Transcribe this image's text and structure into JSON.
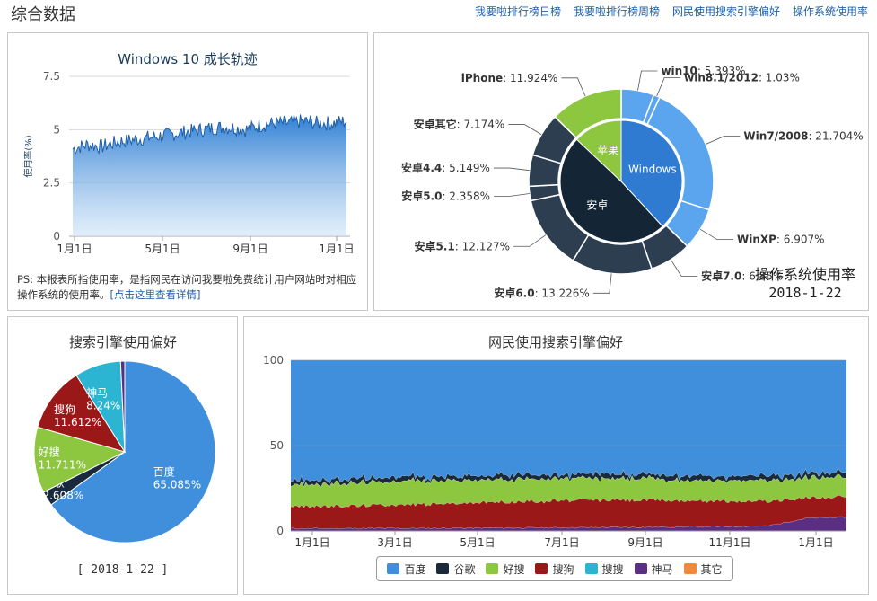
{
  "header": {
    "title": "综合数据",
    "links": [
      "我要啦排行榜日榜",
      "我要啦排行榜周榜",
      "网民使用搜索引擎偏好",
      "操作系统使用率"
    ]
  },
  "colors": {
    "baidu": "#3f8fdc",
    "google": "#1a2a3c",
    "haosou": "#8dc63f",
    "sogou": "#9b1818",
    "shenma": "#2bb5d3",
    "other": "#f08a3a",
    "shenma_dark": "#5a2e83",
    "win_inner": "#2e7bd1",
    "win_outer": "#5aa5ee",
    "android_inner": "#142536",
    "android_outer": "#2c3e50",
    "apple": "#8dc63f"
  },
  "panel1": {
    "ps_text": "PS: 本报表所指使用率，是指网民在访问我要啦免费统计用户网站时对相应操作系统的使用率。",
    "ps_link": "[点击这里查看详情]"
  },
  "panel2": {
    "stamp_title": "操作系统使用率",
    "stamp_date": "2018-1-22"
  },
  "panel3": {
    "date": "[ 2018-1-22 ]"
  },
  "chart_data": [
    {
      "type": "area",
      "title": "Windows 10 成长轨迹",
      "ylabel": "使用率(%)",
      "ylim": [
        0,
        7.5
      ],
      "yticks": [
        0,
        2.5,
        5,
        7.5
      ],
      "xticks": [
        "1月1日",
        "5月1日",
        "9月1日",
        "1月1日"
      ],
      "x_range": [
        "2017-01-01",
        "2018-01-22"
      ],
      "series": [
        {
          "values": [
            4.1,
            4.3,
            4.2,
            4.4,
            4.5,
            4.6,
            4.7,
            4.8,
            4.9,
            5.0,
            5.1,
            5.1,
            5.0,
            5.2,
            5.3,
            5.3,
            5.4,
            5.3,
            5.3,
            5.4
          ]
        }
      ]
    },
    {
      "type": "pie",
      "inner": [
        {
          "label": "Windows",
          "value": 35.1
        },
        {
          "label": "安卓",
          "value": 45.0
        },
        {
          "label": "苹果",
          "value": 11.924
        }
      ],
      "outer": [
        {
          "label": "win10",
          "value": 5.393
        },
        {
          "label": "win8.1/2012",
          "value": 1.03
        },
        {
          "label": "Win7/2008",
          "value": 21.704
        },
        {
          "label": "WinXP",
          "value": 6.907
        },
        {
          "label": "安卓7.0",
          "value": 6.85
        },
        {
          "label": "安卓6.0",
          "value": 13.226
        },
        {
          "label": "安卓5.1",
          "value": 12.127
        },
        {
          "label": "安卓5.0",
          "value": 2.358
        },
        {
          "label": "安卓4.4",
          "value": 5.149
        },
        {
          "label": "安卓其它",
          "value": 7.174
        },
        {
          "label": "iPhone",
          "value": 11.924
        }
      ],
      "labels": [
        {
          "text": "win10: 5.393%"
        },
        {
          "text": "win8.1/2012: 1.03%"
        },
        {
          "text": "Win7/2008: 21.704%"
        },
        {
          "text": "WinXP: 6.907%"
        },
        {
          "text": "安卓7.0: 6.85%"
        },
        {
          "text": "安卓6.0: 13.226%"
        },
        {
          "text": "安卓5.1: 12.127%"
        },
        {
          "text": "安卓5.0: 2.358%"
        },
        {
          "text": "安卓4.4: 5.149%"
        },
        {
          "text": "安卓其它: 7.174%"
        },
        {
          "text": "iPhone: 11.924%"
        }
      ]
    },
    {
      "type": "pie",
      "title": "搜索引擎使用偏好",
      "slices": [
        {
          "label": "百度",
          "value": 65.085
        },
        {
          "label": "谷歌",
          "value": 2.608
        },
        {
          "label": "好搜",
          "value": 11.711
        },
        {
          "label": "搜狗",
          "value": 11.612
        },
        {
          "label": "神马",
          "value": 8.24
        },
        {
          "label": "其它",
          "value": 0.744
        }
      ],
      "value_labels": [
        "65.085%",
        "2.608%",
        "11.711%",
        "11.612%",
        "8.24%"
      ]
    },
    {
      "type": "area",
      "title": "网民使用搜索引擎偏好",
      "stacked": true,
      "ylim": [
        0,
        100
      ],
      "yticks": [
        0,
        50,
        100
      ],
      "xticks": [
        "1月1日",
        "3月1日",
        "5月1日",
        "7月1日",
        "9月1日",
        "11月1日",
        "1月1日"
      ],
      "x_range": [
        "2017-01-01",
        "2018-01-22"
      ],
      "grid": true,
      "legend": "bottom",
      "series": [
        {
          "name": "神马",
          "values": [
            1.5,
            1.5,
            1.6,
            1.6,
            1.7,
            1.8,
            1.9,
            2.0,
            2.2,
            2.3,
            2.5,
            2.6,
            3.0,
            7.5,
            8.2
          ]
        },
        {
          "name": "搜狗",
          "values": [
            13.0,
            13.0,
            13.5,
            14.0,
            14.5,
            15.0,
            15.5,
            16.0,
            16.0,
            16.0,
            15.5,
            15.0,
            14.5,
            12.0,
            11.6
          ]
        },
        {
          "name": "好搜",
          "values": [
            13.0,
            13.0,
            13.5,
            14.0,
            13.5,
            13.0,
            13.0,
            13.0,
            12.5,
            12.5,
            12.0,
            12.0,
            12.0,
            11.8,
            11.7
          ]
        },
        {
          "name": "谷歌",
          "values": [
            2.5,
            2.5,
            2.5,
            2.6,
            2.6,
            2.6,
            2.6,
            2.6,
            2.6,
            2.6,
            2.6,
            2.6,
            2.6,
            2.6,
            2.6
          ]
        },
        {
          "name": "百度",
          "values": [
            70.0,
            70.0,
            68.9,
            67.8,
            67.7,
            67.6,
            67.0,
            66.4,
            66.7,
            66.6,
            67.4,
            67.8,
            67.9,
            66.1,
            65.9
          ]
        },
        {
          "name": "搜搜",
          "values": [
            0,
            0,
            0,
            0,
            0,
            0,
            0,
            0,
            0,
            0,
            0,
            0,
            0,
            0,
            0
          ]
        },
        {
          "name": "其它",
          "values": [
            0,
            0,
            0,
            0,
            0,
            0,
            0,
            0,
            0,
            0,
            0,
            0,
            0,
            0,
            0
          ]
        }
      ],
      "legend_items": [
        "百度",
        "谷歌",
        "好搜",
        "搜狗",
        "搜搜",
        "神马",
        "其它"
      ],
      "legend_colors": [
        "#3f8fdc",
        "#1a2a3c",
        "#8dc63f",
        "#9b1818",
        "#2bb5d3",
        "#5a2e83",
        "#f08a3a"
      ]
    }
  ]
}
